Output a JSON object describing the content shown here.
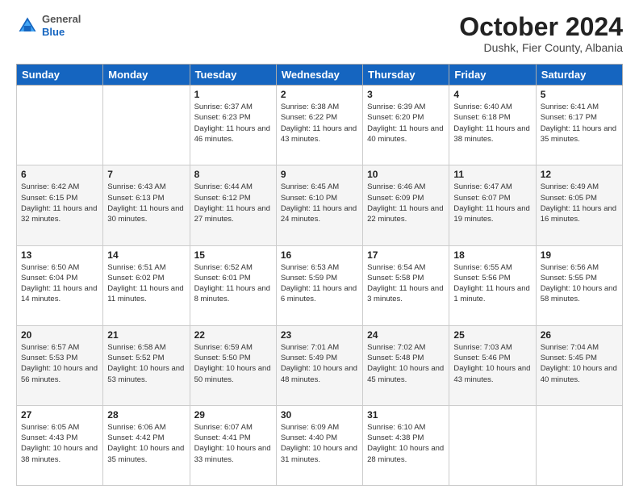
{
  "logo": {
    "general": "General",
    "blue": "Blue"
  },
  "title": "October 2024",
  "subtitle": "Dushk, Fier County, Albania",
  "days_of_week": [
    "Sunday",
    "Monday",
    "Tuesday",
    "Wednesday",
    "Thursday",
    "Friday",
    "Saturday"
  ],
  "weeks": [
    [
      {
        "day": "",
        "sunrise": "",
        "sunset": "",
        "daylight": ""
      },
      {
        "day": "",
        "sunrise": "",
        "sunset": "",
        "daylight": ""
      },
      {
        "day": "1",
        "sunrise": "Sunrise: 6:37 AM",
        "sunset": "Sunset: 6:23 PM",
        "daylight": "Daylight: 11 hours and 46 minutes."
      },
      {
        "day": "2",
        "sunrise": "Sunrise: 6:38 AM",
        "sunset": "Sunset: 6:22 PM",
        "daylight": "Daylight: 11 hours and 43 minutes."
      },
      {
        "day": "3",
        "sunrise": "Sunrise: 6:39 AM",
        "sunset": "Sunset: 6:20 PM",
        "daylight": "Daylight: 11 hours and 40 minutes."
      },
      {
        "day": "4",
        "sunrise": "Sunrise: 6:40 AM",
        "sunset": "Sunset: 6:18 PM",
        "daylight": "Daylight: 11 hours and 38 minutes."
      },
      {
        "day": "5",
        "sunrise": "Sunrise: 6:41 AM",
        "sunset": "Sunset: 6:17 PM",
        "daylight": "Daylight: 11 hours and 35 minutes."
      }
    ],
    [
      {
        "day": "6",
        "sunrise": "Sunrise: 6:42 AM",
        "sunset": "Sunset: 6:15 PM",
        "daylight": "Daylight: 11 hours and 32 minutes."
      },
      {
        "day": "7",
        "sunrise": "Sunrise: 6:43 AM",
        "sunset": "Sunset: 6:13 PM",
        "daylight": "Daylight: 11 hours and 30 minutes."
      },
      {
        "day": "8",
        "sunrise": "Sunrise: 6:44 AM",
        "sunset": "Sunset: 6:12 PM",
        "daylight": "Daylight: 11 hours and 27 minutes."
      },
      {
        "day": "9",
        "sunrise": "Sunrise: 6:45 AM",
        "sunset": "Sunset: 6:10 PM",
        "daylight": "Daylight: 11 hours and 24 minutes."
      },
      {
        "day": "10",
        "sunrise": "Sunrise: 6:46 AM",
        "sunset": "Sunset: 6:09 PM",
        "daylight": "Daylight: 11 hours and 22 minutes."
      },
      {
        "day": "11",
        "sunrise": "Sunrise: 6:47 AM",
        "sunset": "Sunset: 6:07 PM",
        "daylight": "Daylight: 11 hours and 19 minutes."
      },
      {
        "day": "12",
        "sunrise": "Sunrise: 6:49 AM",
        "sunset": "Sunset: 6:05 PM",
        "daylight": "Daylight: 11 hours and 16 minutes."
      }
    ],
    [
      {
        "day": "13",
        "sunrise": "Sunrise: 6:50 AM",
        "sunset": "Sunset: 6:04 PM",
        "daylight": "Daylight: 11 hours and 14 minutes."
      },
      {
        "day": "14",
        "sunrise": "Sunrise: 6:51 AM",
        "sunset": "Sunset: 6:02 PM",
        "daylight": "Daylight: 11 hours and 11 minutes."
      },
      {
        "day": "15",
        "sunrise": "Sunrise: 6:52 AM",
        "sunset": "Sunset: 6:01 PM",
        "daylight": "Daylight: 11 hours and 8 minutes."
      },
      {
        "day": "16",
        "sunrise": "Sunrise: 6:53 AM",
        "sunset": "Sunset: 5:59 PM",
        "daylight": "Daylight: 11 hours and 6 minutes."
      },
      {
        "day": "17",
        "sunrise": "Sunrise: 6:54 AM",
        "sunset": "Sunset: 5:58 PM",
        "daylight": "Daylight: 11 hours and 3 minutes."
      },
      {
        "day": "18",
        "sunrise": "Sunrise: 6:55 AM",
        "sunset": "Sunset: 5:56 PM",
        "daylight": "Daylight: 11 hours and 1 minute."
      },
      {
        "day": "19",
        "sunrise": "Sunrise: 6:56 AM",
        "sunset": "Sunset: 5:55 PM",
        "daylight": "Daylight: 10 hours and 58 minutes."
      }
    ],
    [
      {
        "day": "20",
        "sunrise": "Sunrise: 6:57 AM",
        "sunset": "Sunset: 5:53 PM",
        "daylight": "Daylight: 10 hours and 56 minutes."
      },
      {
        "day": "21",
        "sunrise": "Sunrise: 6:58 AM",
        "sunset": "Sunset: 5:52 PM",
        "daylight": "Daylight: 10 hours and 53 minutes."
      },
      {
        "day": "22",
        "sunrise": "Sunrise: 6:59 AM",
        "sunset": "Sunset: 5:50 PM",
        "daylight": "Daylight: 10 hours and 50 minutes."
      },
      {
        "day": "23",
        "sunrise": "Sunrise: 7:01 AM",
        "sunset": "Sunset: 5:49 PM",
        "daylight": "Daylight: 10 hours and 48 minutes."
      },
      {
        "day": "24",
        "sunrise": "Sunrise: 7:02 AM",
        "sunset": "Sunset: 5:48 PM",
        "daylight": "Daylight: 10 hours and 45 minutes."
      },
      {
        "day": "25",
        "sunrise": "Sunrise: 7:03 AM",
        "sunset": "Sunset: 5:46 PM",
        "daylight": "Daylight: 10 hours and 43 minutes."
      },
      {
        "day": "26",
        "sunrise": "Sunrise: 7:04 AM",
        "sunset": "Sunset: 5:45 PM",
        "daylight": "Daylight: 10 hours and 40 minutes."
      }
    ],
    [
      {
        "day": "27",
        "sunrise": "Sunrise: 6:05 AM",
        "sunset": "Sunset: 4:43 PM",
        "daylight": "Daylight: 10 hours and 38 minutes."
      },
      {
        "day": "28",
        "sunrise": "Sunrise: 6:06 AM",
        "sunset": "Sunset: 4:42 PM",
        "daylight": "Daylight: 10 hours and 35 minutes."
      },
      {
        "day": "29",
        "sunrise": "Sunrise: 6:07 AM",
        "sunset": "Sunset: 4:41 PM",
        "daylight": "Daylight: 10 hours and 33 minutes."
      },
      {
        "day": "30",
        "sunrise": "Sunrise: 6:09 AM",
        "sunset": "Sunset: 4:40 PM",
        "daylight": "Daylight: 10 hours and 31 minutes."
      },
      {
        "day": "31",
        "sunrise": "Sunrise: 6:10 AM",
        "sunset": "Sunset: 4:38 PM",
        "daylight": "Daylight: 10 hours and 28 minutes."
      },
      {
        "day": "",
        "sunrise": "",
        "sunset": "",
        "daylight": ""
      },
      {
        "day": "",
        "sunrise": "",
        "sunset": "",
        "daylight": ""
      }
    ]
  ]
}
